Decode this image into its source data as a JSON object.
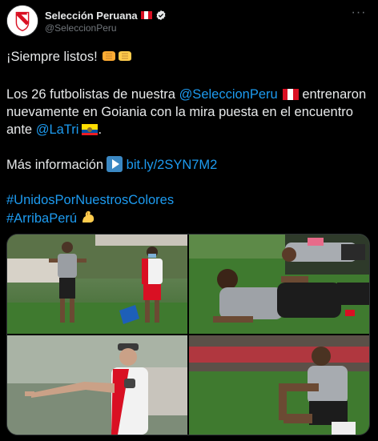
{
  "account": {
    "name": "Selección Peruana",
    "handle": "@SeleccionPeru",
    "avatar_icon": "fpf-crest-icon",
    "flag_icon": "peru-flag-icon",
    "verified_icon": "verified-badge-icon",
    "menu_icon": "more-options-icon",
    "menu_glyph": "···"
  },
  "tweet": {
    "line1": "¡Siempre listos!",
    "line1_emoji": "fist-bump-emoji",
    "p2_a": "Los 26 futbolistas de nuestra ",
    "p2_mention": "@SeleccionPeru",
    "p2_b": "entrenaron nuevamente en Goiania con la mira puesta en el encuentro ante ",
    "p2_mention2": "@LaTri",
    "p2_end": ".",
    "info_label": "Más información",
    "info_link": "bit.ly/2SYN7M2",
    "hashtag1": "#UnidosPorNuestrosColores",
    "hashtag2": "#ArribaPerú",
    "hashtag2_emoji": "flexed-biceps-emoji"
  },
  "media": {
    "photos": [
      {
        "name": "photo-players-running"
      },
      {
        "name": "photo-player-stretching-grass"
      },
      {
        "name": "photo-coach-pointing"
      },
      {
        "name": "photo-player-sitting"
      }
    ]
  },
  "colors": {
    "background": "#000000",
    "text": "#e7e9ea",
    "muted": "#71767b",
    "link": "#1d9bf0",
    "peru_red": "#d91023",
    "verified": "#e7e9ea"
  }
}
